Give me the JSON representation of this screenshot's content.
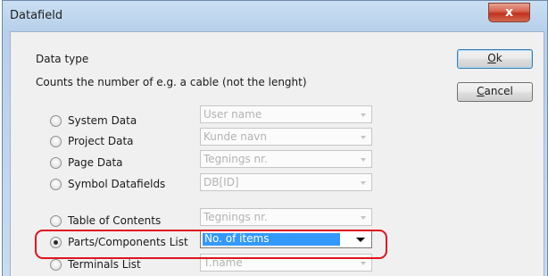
{
  "window": {
    "title": "Datafield",
    "close_label": "x"
  },
  "group": {
    "title": "Data type",
    "description": "Counts the number of e.g. a cable (not the lenght)"
  },
  "buttons": {
    "ok_label": "Ok",
    "ok_underline": "O",
    "ok_rest": "k",
    "cancel_label": "Cancel",
    "cancel_underline": "C",
    "cancel_rest": "ancel"
  },
  "options": [
    {
      "label": "System Data",
      "combo_value": "User name",
      "selected": false,
      "enabled": false
    },
    {
      "label": "Project Data",
      "combo_value": "Kunde navn",
      "selected": false,
      "enabled": false
    },
    {
      "label": "Page Data",
      "combo_value": "Tegnings nr.",
      "selected": false,
      "enabled": false
    },
    {
      "label": "Symbol Datafields",
      "combo_value": "DB[ID]",
      "selected": false,
      "enabled": false
    },
    {
      "label": "Table of Contents",
      "combo_value": "Tegnings nr.",
      "selected": false,
      "enabled": false
    },
    {
      "label": "Parts/Components List",
      "combo_value": "No. of items",
      "selected": true,
      "enabled": true
    },
    {
      "label": "Terminals List",
      "combo_value": "T.name",
      "selected": false,
      "enabled": false
    }
  ],
  "colors": {
    "highlight": "#e0141e",
    "selection": "#3399ff",
    "close": "#c0301c"
  }
}
